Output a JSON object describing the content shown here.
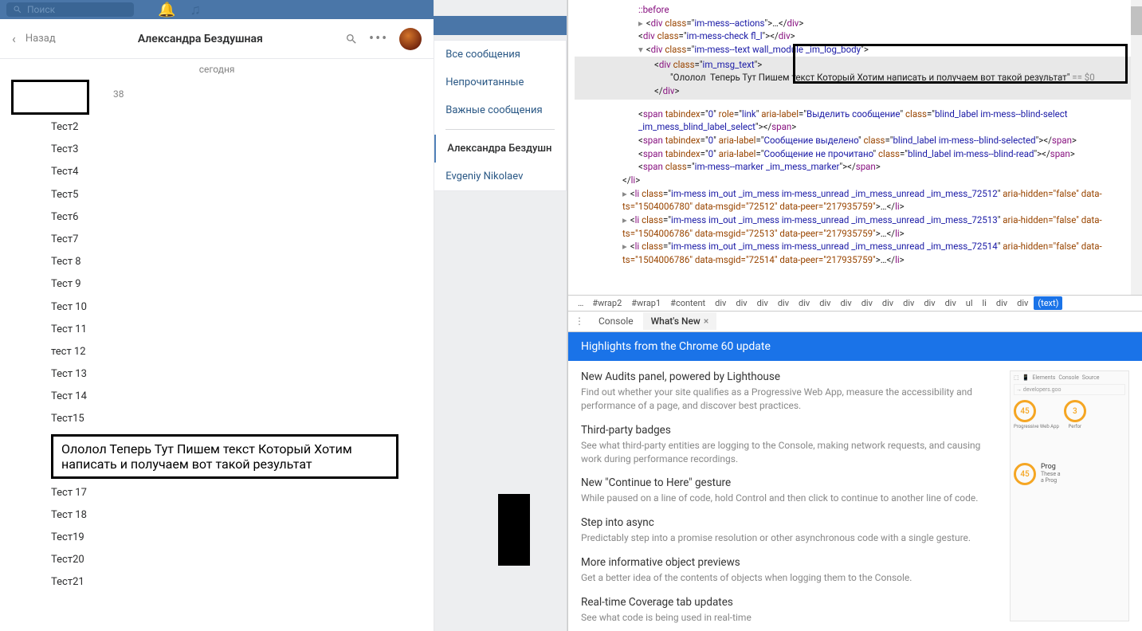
{
  "topbar": {
    "search_placeholder": "Поиск"
  },
  "chat": {
    "back_label": "Назад",
    "title": "Александра Бездушная",
    "date_label": "сегодня",
    "time": "38",
    "messages": [
      "Тест2",
      "Тест3",
      "Тест4",
      "Тест5",
      "Тест6",
      "Тест7",
      "Тест 8",
      "Тест 9",
      "Тест 10",
      "Тест 11",
      "тест 12",
      "Тест 13",
      "Тест 14",
      "Тест15"
    ],
    "highlighted": "Ололол Теперь Тут Пишем текст Который Хотим написать и получаем вот такой результат",
    "messages_after": [
      "Тест 17",
      "Тест 18",
      "Тест19",
      "Тест20",
      "Тест21"
    ]
  },
  "sidebar": {
    "items": [
      "Все сообщения",
      "Непрочитанные",
      "Важные сообщения"
    ],
    "active": "Александра Бездушн",
    "other": "Evgeniy Nikolaev"
  },
  "devtools": {
    "before": "::before",
    "line1_class": "im-mess--actions",
    "line2_class": "im-mess-check fl_l",
    "line3_class": "im-mess--text wall_module _im_log_body",
    "line4_class": "im_msg_text",
    "selected_text": "\"Ололол  Теперь Тут Пишем текст Который Хотим написать и получаем вот такой результат\"",
    "eq0": "== $0",
    "span1_label": "Выделить сообщение",
    "span1_class": "blind_label im-mess--blind-select _im_mess_blind_label_select",
    "span2_label": "Сообщение выделено",
    "span2_class": "blind_label im-mess--blind-selected",
    "span3_label": "Сообщение не прочитано",
    "span3_class": "blind_label im-mess--blind-read",
    "span4_class": "im-mess--marker _im_mess_marker",
    "li1_class": "im-mess im_out _im_mess im-mess_unread _im_mess_unread _im_mess_72512",
    "li1_attrs": "aria-hidden=\"false\" data-ts=\"1504006780\" data-msgid=\"72512\" data-peer=\"217935759\"",
    "li2_class": "im-mess im_out _im_mess im-mess_unread _im_mess_unread _im_mess_72513",
    "li2_attrs": "aria-hidden=\"false\" data-ts=\"1504006786\" data-msgid=\"72513\" data-peer=\"217935759\"",
    "li3_class": "im-mess im_out _im_mess im-mess_unread _im_mess_unread _im_mess_72514",
    "li3_attrs": "aria-hidden=\"false\" data-ts=\"1504006786\" data-msgid=\"72514\" data-peer=\"217935759\"",
    "breadcrumb": [
      "#wrap2",
      "#wrap1",
      "#content",
      "div",
      "div",
      "div",
      "div",
      "div",
      "div",
      "div",
      "div",
      "div",
      "div",
      "div",
      "div",
      "ul",
      "li",
      "div",
      "div",
      "(text)"
    ],
    "console_tab": "Console",
    "whatsnew_tab": "What's New"
  },
  "whatsnew": {
    "header": "Highlights from the Chrome 60 update",
    "items": [
      {
        "title": "New Audits panel, powered by Lighthouse",
        "desc": "Find out whether your site qualifies as a Progressive Web App, measure the accessibility and performance of a page, and discover best practices."
      },
      {
        "title": "Third-party badges",
        "desc": "See what third-party entities are logging to the Console, making network requests, and causing work during performance recordings."
      },
      {
        "title": "New \"Continue to Here\" gesture",
        "desc": "While paused on a line of code, hold Control and then click to continue to another line of code."
      },
      {
        "title": "Step into async",
        "desc": "Predictably step into a promise resolution or other asynchronous code with a single gesture."
      },
      {
        "title": "More informative object previews",
        "desc": "Get a better idea of the contents of objects when logging them to the Console."
      },
      {
        "title": "Real-time Coverage tab updates",
        "desc": "See what code is being used in real-time"
      }
    ],
    "side": {
      "tabs": [
        "Elements",
        "Console",
        "Source"
      ],
      "url": "developers.goo",
      "score": "45",
      "score2": "3",
      "label1": "Progressive Web App",
      "label2": "Perfor",
      "score3": "45",
      "t3": "Prog",
      "t4": "These a",
      "t5": "a Prog"
    }
  }
}
